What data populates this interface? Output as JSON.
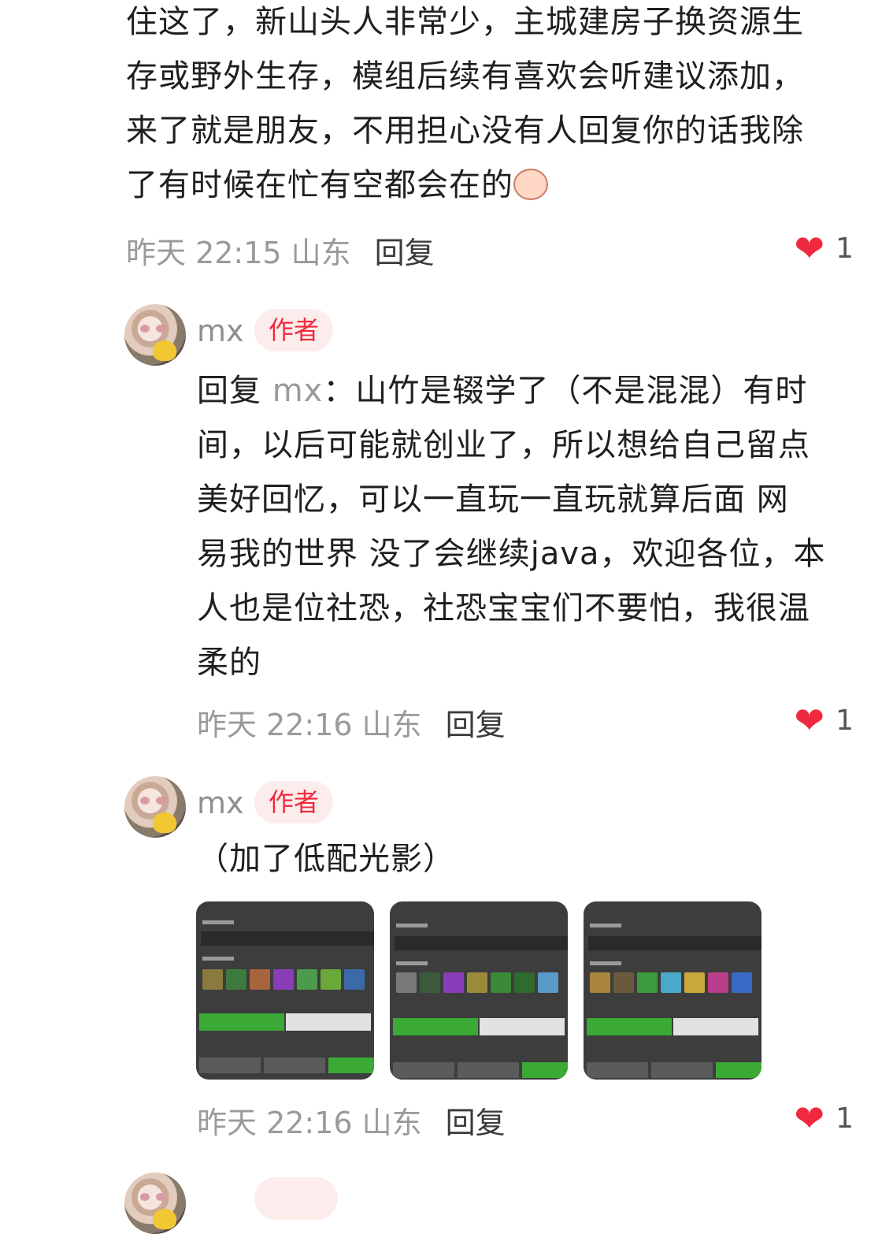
{
  "comments": [
    {
      "text_lines": [
        "住这了，新山头人非常少，主城建房子换资源生",
        "存或野外生存，模组后续有喜欢会听建议添加，",
        "来了就是朋友，不用担心没有人回复你的话我除",
        "了有时候在忙有空都会在的"
      ],
      "emoji": "baby-face-emoji",
      "time": "昨天 22:15 山东",
      "reply_label": "回复",
      "likes": "1"
    },
    {
      "username": "mx",
      "badge": "作者",
      "reply_prefix": "回复",
      "reply_to": "mx",
      "reply_sep": "：",
      "text_lines": [
        "山竹是辍学了（不是混混）有时",
        "间，以后可能就创业了，所以想给自己留点",
        "美好回忆，可以一直玩一直玩就算后面 网",
        "易我的世界 没了会继续java，欢迎各位，本",
        "人也是位社恐，社恐宝宝们不要怕，我很温",
        "柔的"
      ],
      "time": "昨天 22:16 山东",
      "reply_label": "回复",
      "likes": "1"
    },
    {
      "username": "mx",
      "badge": "作者",
      "text": "（加了低配光影）",
      "images": [
        {
          "title": "世界名称",
          "subtitle": "承老了一破子就这了"
        },
        {
          "title": "世界名称",
          "subtitle": "承老了一破子就这了"
        },
        {
          "title": "世界名称",
          "subtitle": "承老了一破子就这了"
        }
      ],
      "time": "昨天 22:16 山东",
      "reply_label": "回复",
      "likes": "1"
    }
  ],
  "colors": {
    "heart": "#f0293e",
    "badge_text": "#f02a3c",
    "badge_bg": "#fdecec",
    "meta_grey": "#9a9a9a"
  },
  "icons": {
    "like": "heart-icon"
  }
}
